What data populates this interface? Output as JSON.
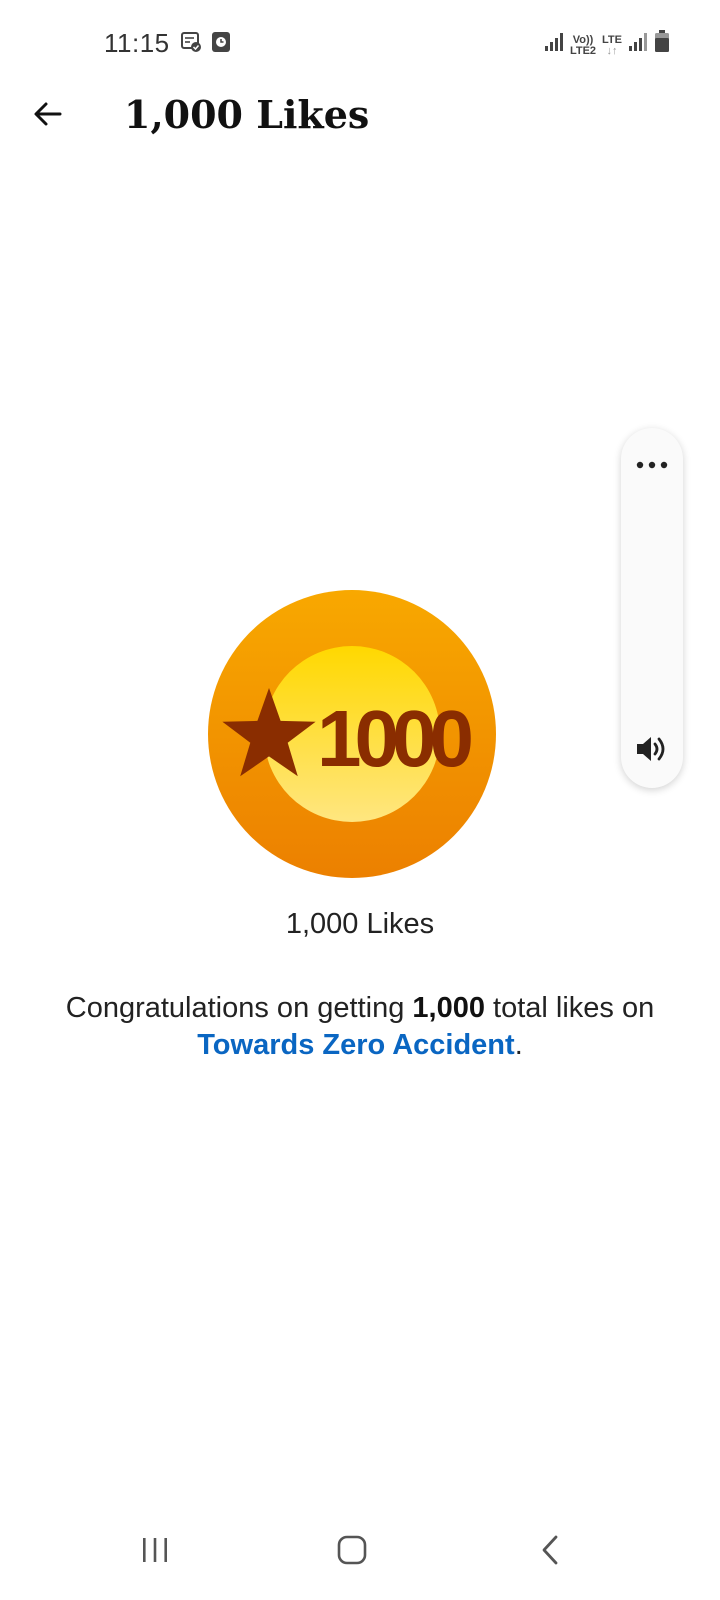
{
  "status_bar": {
    "time": "11:15",
    "volte_top": "Vo))",
    "volte_bottom": "LTE2",
    "lte_label": "LTE"
  },
  "header": {
    "title": "1,000 Likes"
  },
  "badge": {
    "number": "1000",
    "caption": "1,000 Likes",
    "colors": {
      "outer_top": "#f8a800",
      "outer_bottom": "#ec8000",
      "inner_top": "#ffd800",
      "inner_bottom": "#ffe680",
      "mark": "#8a2d00"
    }
  },
  "message": {
    "prefix": "Congratulations on getting ",
    "count": "1,000",
    "middle": " total likes on ",
    "link": "Towards Zero Accident",
    "suffix": "."
  },
  "colors": {
    "link": "#0a66c2"
  }
}
